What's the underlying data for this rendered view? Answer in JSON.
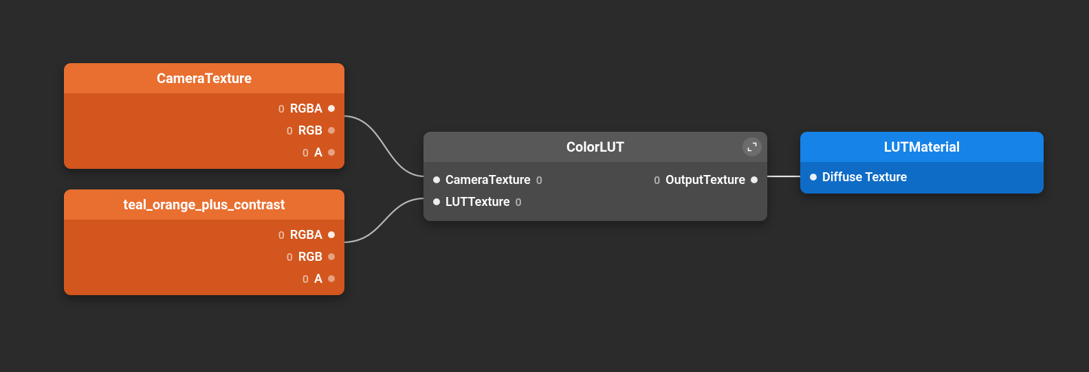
{
  "nodes": {
    "cameraTexture": {
      "title": "CameraTexture",
      "outputs": [
        "RGBA",
        "RGB",
        "A"
      ]
    },
    "tealOrange": {
      "title": "teal_orange_plus_contrast",
      "outputs": [
        "RGBA",
        "RGB",
        "A"
      ]
    },
    "colorLUT": {
      "title": "ColorLUT",
      "inputs": [
        "CameraTexture",
        "LUTTexture"
      ],
      "outputs": [
        "OutputTexture"
      ]
    },
    "lutMaterial": {
      "title": "LUTMaterial",
      "inputs": [
        "Diffuse Texture"
      ]
    }
  },
  "connections": [
    {
      "from": "cameraTexture.RGBA",
      "to": "colorLUT.CameraTexture"
    },
    {
      "from": "tealOrange.RGBA",
      "to": "colorLUT.LUTTexture"
    },
    {
      "from": "colorLUT.OutputTexture",
      "to": "lutMaterial.Diffuse Texture"
    }
  ],
  "zero": "0"
}
